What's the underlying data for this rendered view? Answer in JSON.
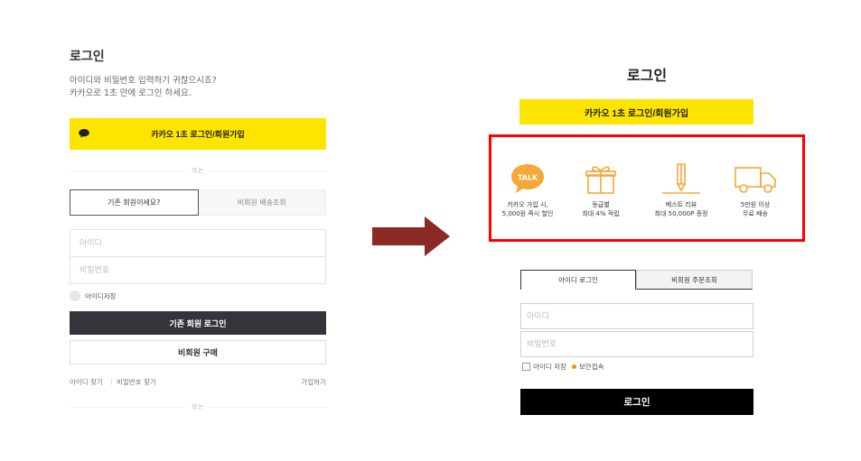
{
  "left": {
    "title": "로그인",
    "desc_line1": "아이디와 비밀번호 입력하기 귀찮으시죠?",
    "desc_line2": "카카오로 1초 만에 로그인 하세요.",
    "kakao_button": "카카오 1초 로그인/회원가입",
    "or_text": "또는",
    "tabs": [
      "기존 회원이세요?",
      "비회원 배송조회"
    ],
    "id_placeholder": "아이디",
    "pw_placeholder": "비밀번호",
    "save_id": "아이디저장",
    "login_button": "기존 회원 로그인",
    "guest_button": "비회원 구매",
    "find_id": "아이디 찾기",
    "separator": "|",
    "find_pw": "비밀번호 찾기",
    "join": "가입하기"
  },
  "right": {
    "title": "로그인",
    "kakao_button": "카카오 1초 로그인/회원가입",
    "benefits": [
      {
        "icon": "kakao-talk-icon",
        "line1": "카카오 가입 시,",
        "line2": "5,000원 즉시 할인"
      },
      {
        "icon": "gift-icon",
        "line1": "등급별",
        "line2": "최대 4% 적립"
      },
      {
        "icon": "pencil-icon",
        "line1": "베스트 리뷰",
        "line2": "최대 50,000P 증정"
      },
      {
        "icon": "truck-icon",
        "line1": "5만원 이상",
        "line2": "무료 배송"
      }
    ],
    "talk_badge": "TALK",
    "tabs": [
      "아이디 로그인",
      "비회원 주문조회"
    ],
    "id_placeholder": "아이디",
    "pw_placeholder": "비밀번호",
    "save_id": "아이디 저장",
    "secure_login": "보안접속",
    "login_button": "로그인"
  },
  "colors": {
    "kakao_yellow": "#fee500",
    "highlight_red": "#ff0000",
    "arrow_red": "#8b2a24",
    "icon_orange": "#f4a83a",
    "dark_button": "#33353a"
  }
}
